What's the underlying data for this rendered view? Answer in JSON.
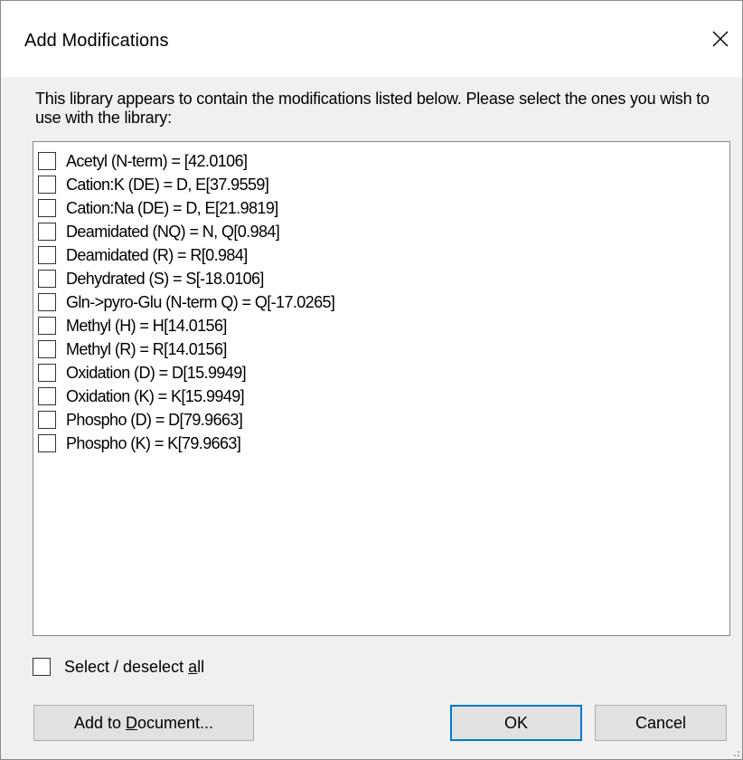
{
  "window": {
    "title": "Add Modifications",
    "close_icon": "close-icon"
  },
  "intro_text": "This library appears to contain the modifications listed below. Please select the ones you wish to use with the library:",
  "modifications": [
    {
      "label": "Acetyl (N-term) = [42.0106]",
      "checked": false
    },
    {
      "label": "Cation:K (DE) = D, E[37.9559]",
      "checked": false
    },
    {
      "label": "Cation:Na (DE) = D, E[21.9819]",
      "checked": false
    },
    {
      "label": "Deamidated (NQ) = N, Q[0.984]",
      "checked": false
    },
    {
      "label": "Deamidated (R) = R[0.984]",
      "checked": false
    },
    {
      "label": "Dehydrated (S) = S[-18.0106]",
      "checked": false
    },
    {
      "label": "Gln->pyro-Glu (N-term Q) = Q[-17.0265]",
      "checked": false
    },
    {
      "label": "Methyl (H) = H[14.0156]",
      "checked": false
    },
    {
      "label": "Methyl (R) = R[14.0156]",
      "checked": false
    },
    {
      "label": "Oxidation (D) = D[15.9949]",
      "checked": false
    },
    {
      "label": "Oxidation (K) = K[15.9949]",
      "checked": false
    },
    {
      "label": "Phospho (D) = D[79.9663]",
      "checked": false
    },
    {
      "label": "Phospho (K) = K[79.9663]",
      "checked": false
    }
  ],
  "select_all": {
    "label_before": "Select / deselect ",
    "label_accel": "a",
    "label_after": "ll",
    "checked": false
  },
  "buttons": {
    "add_to_document": {
      "before": "Add to ",
      "accel": "D",
      "after": "ocument..."
    },
    "ok": "OK",
    "cancel": "Cancel"
  },
  "colors": {
    "dialog_background": "#f0f0f0",
    "focus_border": "#0078d7",
    "button_face": "#e1e1e1"
  }
}
